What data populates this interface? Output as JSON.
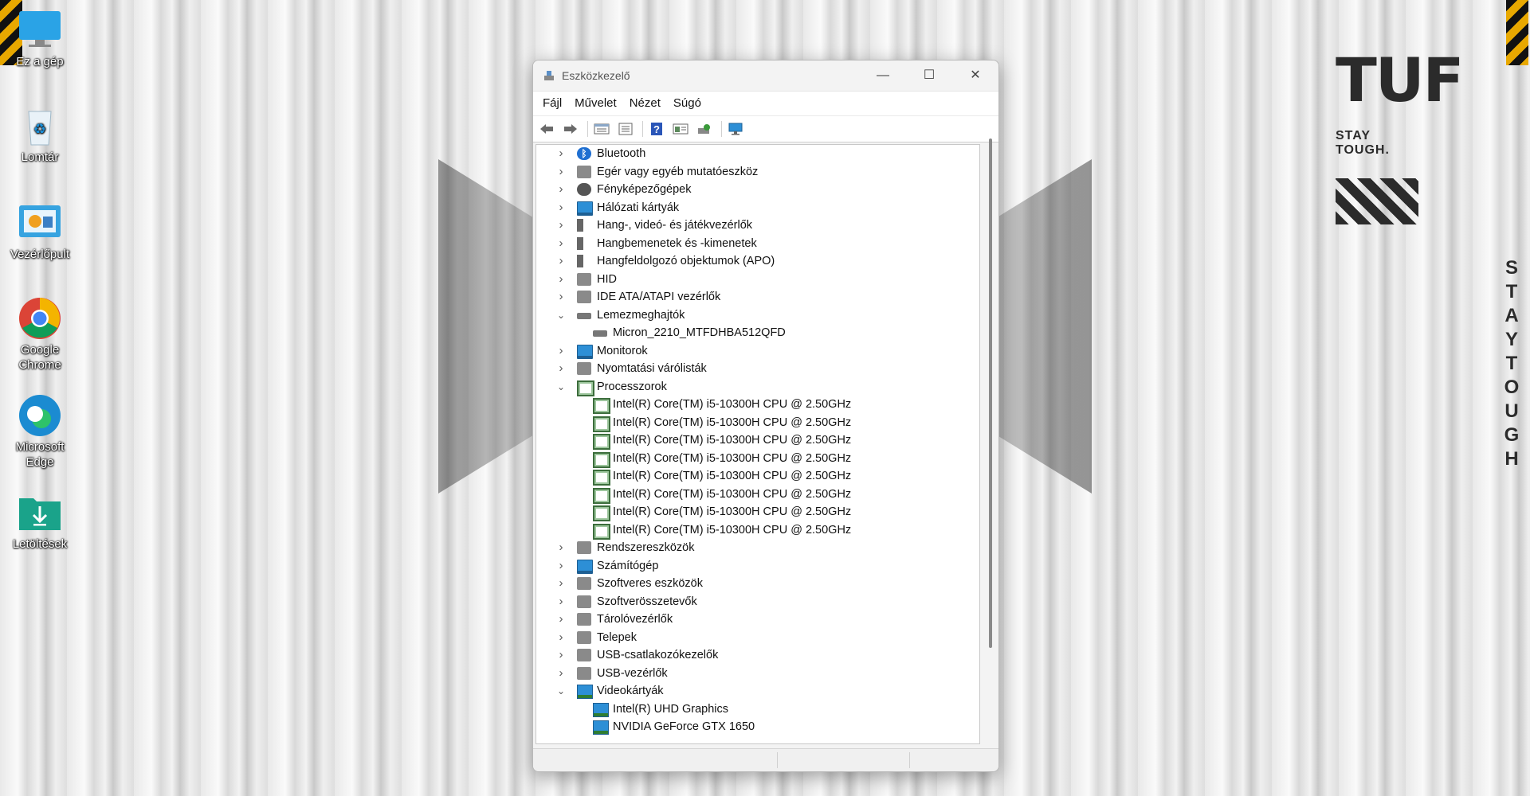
{
  "desktop": {
    "icons": [
      {
        "label": "Ez a gép",
        "icon": "monitor-icon"
      },
      {
        "label": "Lomtár",
        "icon": "recycle-bin-icon"
      },
      {
        "label": "Vezérlőpult",
        "icon": "control-panel-icon"
      },
      {
        "label": "Google Chrome",
        "icon": "chrome-icon"
      },
      {
        "label": "Microsoft Edge",
        "icon": "edge-icon"
      },
      {
        "label": "Letöltések",
        "icon": "downloads-folder-icon"
      }
    ],
    "wallpaper": {
      "logo": "TUF",
      "tagline": "STAY TOUGH.",
      "vertical_text": "STAY TOUGH"
    }
  },
  "window": {
    "title": "Eszközkezelő",
    "controls": {
      "minimize": "—",
      "maximize": "☐",
      "close": "✕"
    },
    "menu": [
      "Fájl",
      "Művelet",
      "Nézet",
      "Súgó"
    ],
    "toolbar": [
      "back-icon",
      "forward-icon",
      "properties-view-icon",
      "list-view-icon",
      "help-icon",
      "resources-view-icon",
      "update-driver-icon",
      "scan-hardware-icon"
    ],
    "tree": [
      {
        "label": "Bluetooth",
        "level": 0,
        "state": "collapsed",
        "icon": "bluetooth"
      },
      {
        "label": "Egér vagy egyéb mutatóeszköz",
        "level": 0,
        "state": "collapsed",
        "icon": "mouse"
      },
      {
        "label": "Fényképezőgépek",
        "level": 0,
        "state": "collapsed",
        "icon": "camera"
      },
      {
        "label": "Hálózati kártyák",
        "level": 0,
        "state": "collapsed",
        "icon": "network"
      },
      {
        "label": "Hang-, videó- és játékvezérlők",
        "level": 0,
        "state": "collapsed",
        "icon": "speaker"
      },
      {
        "label": "Hangbemenetek és -kimenetek",
        "level": 0,
        "state": "collapsed",
        "icon": "speaker"
      },
      {
        "label": "Hangfeldolgozó objektumok (APO)",
        "level": 0,
        "state": "collapsed",
        "icon": "speaker"
      },
      {
        "label": "HID",
        "level": 0,
        "state": "collapsed",
        "icon": "hid"
      },
      {
        "label": "IDE ATA/ATAPI vezérlők",
        "level": 0,
        "state": "collapsed",
        "icon": "ide"
      },
      {
        "label": "Lemezmeghajtók",
        "level": 0,
        "state": "expanded",
        "icon": "disk"
      },
      {
        "label": "Micron_2210_MTFDHBA512QFD",
        "level": 1,
        "state": "leaf",
        "icon": "disk"
      },
      {
        "label": "Monitorok",
        "level": 0,
        "state": "collapsed",
        "icon": "monitor"
      },
      {
        "label": "Nyomtatási várólisták",
        "level": 0,
        "state": "collapsed",
        "icon": "printer"
      },
      {
        "label": "Processzorok",
        "level": 0,
        "state": "expanded",
        "icon": "cpu"
      },
      {
        "label": "Intel(R) Core(TM) i5-10300H CPU @ 2.50GHz",
        "level": 1,
        "state": "leaf",
        "icon": "cpu"
      },
      {
        "label": "Intel(R) Core(TM) i5-10300H CPU @ 2.50GHz",
        "level": 1,
        "state": "leaf",
        "icon": "cpu"
      },
      {
        "label": "Intel(R) Core(TM) i5-10300H CPU @ 2.50GHz",
        "level": 1,
        "state": "leaf",
        "icon": "cpu"
      },
      {
        "label": "Intel(R) Core(TM) i5-10300H CPU @ 2.50GHz",
        "level": 1,
        "state": "leaf",
        "icon": "cpu"
      },
      {
        "label": "Intel(R) Core(TM) i5-10300H CPU @ 2.50GHz",
        "level": 1,
        "state": "leaf",
        "icon": "cpu"
      },
      {
        "label": "Intel(R) Core(TM) i5-10300H CPU @ 2.50GHz",
        "level": 1,
        "state": "leaf",
        "icon": "cpu"
      },
      {
        "label": "Intel(R) Core(TM) i5-10300H CPU @ 2.50GHz",
        "level": 1,
        "state": "leaf",
        "icon": "cpu"
      },
      {
        "label": "Intel(R) Core(TM) i5-10300H CPU @ 2.50GHz",
        "level": 1,
        "state": "leaf",
        "icon": "cpu"
      },
      {
        "label": "Rendszereszközök",
        "level": 0,
        "state": "collapsed",
        "icon": "system"
      },
      {
        "label": "Számítógép",
        "level": 0,
        "state": "collapsed",
        "icon": "monitor"
      },
      {
        "label": "Szoftveres eszközök",
        "level": 0,
        "state": "collapsed",
        "icon": "software"
      },
      {
        "label": "Szoftverösszetevők",
        "level": 0,
        "state": "collapsed",
        "icon": "software-component"
      },
      {
        "label": "Tárolóvezérlők",
        "level": 0,
        "state": "collapsed",
        "icon": "storage"
      },
      {
        "label": "Telepek",
        "level": 0,
        "state": "collapsed",
        "icon": "battery"
      },
      {
        "label": "USB-csatlakozókezelők",
        "level": 0,
        "state": "collapsed",
        "icon": "usb"
      },
      {
        "label": "USB-vezérlők",
        "level": 0,
        "state": "collapsed",
        "icon": "usb"
      },
      {
        "label": "Videokártyák",
        "level": 0,
        "state": "expanded",
        "icon": "gpu"
      },
      {
        "label": "Intel(R) UHD Graphics",
        "level": 1,
        "state": "leaf",
        "icon": "gpu"
      },
      {
        "label": "NVIDIA GeForce GTX 1650",
        "level": 1,
        "state": "leaf",
        "icon": "gpu"
      }
    ]
  }
}
